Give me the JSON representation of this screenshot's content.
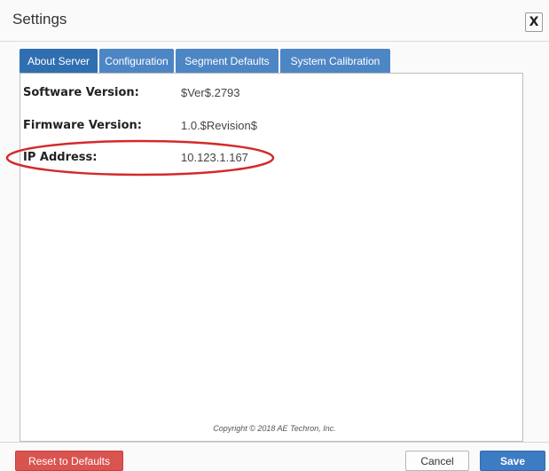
{
  "dialog": {
    "title": "Settings",
    "close_label": "X"
  },
  "tabs": [
    {
      "label": "About Server",
      "active": true
    },
    {
      "label": "Configuration",
      "active": false
    },
    {
      "label": "Segment Defaults",
      "active": false
    },
    {
      "label": "System Calibration",
      "active": false
    }
  ],
  "about": {
    "software_version_label": "Software Version:",
    "software_version_value": "$Ver$.2793",
    "firmware_version_label": "Firmware Version:",
    "firmware_version_value": "1.0.$Revision$",
    "ip_address_label": "IP Address:",
    "ip_address_value": "10.123.1.167"
  },
  "copyright": "Copyright © 2018 AE Techron, Inc.",
  "footer": {
    "reset_label": "Reset to Defaults",
    "cancel_label": "Cancel",
    "save_label": "Save"
  },
  "colors": {
    "tab_active": "#2f6fb1",
    "tab_inactive": "#4d86c5",
    "reset_button": "#d9534f",
    "save_button": "#3d7cc3",
    "highlight_ellipse": "#d42a2a"
  }
}
